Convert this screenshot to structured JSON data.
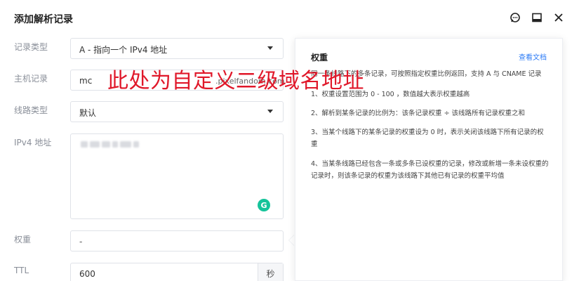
{
  "dialog": {
    "title": "添加解析记录",
    "icons": [
      "feedback-icon",
      "minimize-icon",
      "close-icon"
    ]
  },
  "form": {
    "record_type": {
      "label": "记录类型",
      "value": "A - 指向一个 IPv4 地址"
    },
    "host": {
      "label": "主机记录",
      "value": "mc",
      "suffix": ".pixelfandom.com"
    },
    "line": {
      "label": "线路类型",
      "value": "默认"
    },
    "ipv4": {
      "label": "IPv4 地址"
    },
    "weight": {
      "label": "权重",
      "value": "-"
    },
    "ttl": {
      "label": "TTL",
      "value": "600",
      "unit": "秒"
    }
  },
  "help": {
    "title": "权重",
    "link": "查看文档",
    "lines": [
      "同一条线路下的多条记录，可按照指定权重比例返回，支持 A 与 CNAME 记录",
      "1、权重设置范围为 0 - 100 ，数值越大表示权重越高",
      "2、解析到某条记录的比例为：该条记录权重 ÷ 该线路所有记录权重之和",
      "3、当某个线路下的某条记录的权重设为 0 时，表示关闭该线路下所有记录的权重",
      "4、当某条线路已经包含一条或多条已设权重的记录，修改或新增一条未设权重的记录时，则该条记录的权重为该线路下其他已有记录的权重平均值"
    ]
  },
  "annotation": {
    "text": "此处为自定义二级域名地址",
    "color": "#e0182a"
  },
  "colors": {
    "accent": "#2f7df6",
    "grammarly": "#15c39a"
  }
}
